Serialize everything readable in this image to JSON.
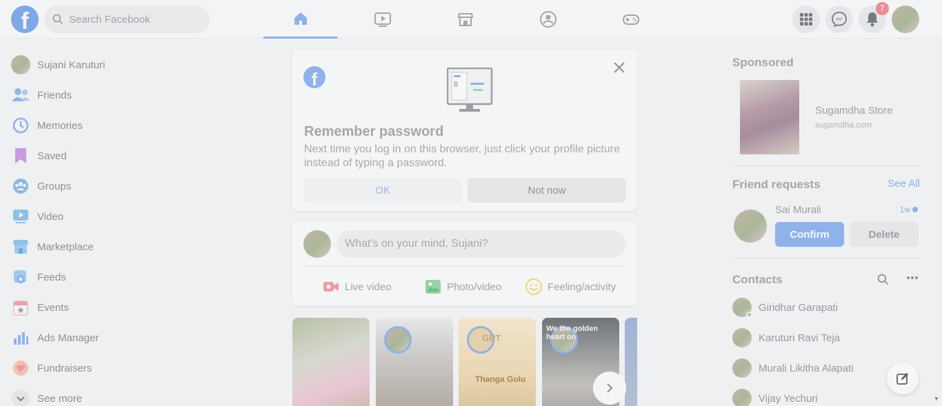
{
  "app": {
    "logo": "f"
  },
  "search": {
    "placeholder": "Search Facebook"
  },
  "nav": {
    "tabs": [
      {
        "name": "home-icon"
      },
      {
        "name": "watch-icon"
      },
      {
        "name": "marketplace-icon"
      },
      {
        "name": "groups-icon"
      },
      {
        "name": "gaming-icon"
      }
    ],
    "notifications_count": "7"
  },
  "sidebar": {
    "profile_name": "Sujani Karuturi",
    "items": [
      {
        "label": "Friends",
        "icon": "friends-icon"
      },
      {
        "label": "Memories",
        "icon": "memories-icon"
      },
      {
        "label": "Saved",
        "icon": "saved-icon"
      },
      {
        "label": "Groups",
        "icon": "groups-icon"
      },
      {
        "label": "Video",
        "icon": "video-icon"
      },
      {
        "label": "Marketplace",
        "icon": "marketplace-icon"
      },
      {
        "label": "Feeds",
        "icon": "feeds-icon"
      },
      {
        "label": "Events",
        "icon": "events-icon"
      },
      {
        "label": "Ads Manager",
        "icon": "ads-manager-icon"
      },
      {
        "label": "Fundraisers",
        "icon": "fundraisers-icon"
      }
    ],
    "see_more": "See more"
  },
  "remember_password": {
    "title": "Remember password",
    "description": "Next time you log in on this browser, just click your profile picture instead of typing a password.",
    "ok_label": "OK",
    "not_now_label": "Not now"
  },
  "composer": {
    "placeholder": "What's on your mind, Sujani?",
    "actions": [
      "Live video",
      "Photo/video",
      "Feeling/activity"
    ]
  },
  "stories": {
    "story3_text": "Thanga Golu",
    "story3_logo": "GRT",
    "story4_text": "We the golden heart on"
  },
  "right": {
    "sponsored_title": "Sponsored",
    "ad": {
      "name": "Sugamdha Store",
      "url": "sugamdha.com"
    },
    "friend_requests_title": "Friend requests",
    "see_all": "See All",
    "request": {
      "name": "Sai Murali",
      "time": "1w",
      "confirm": "Confirm",
      "delete": "Delete"
    },
    "contacts_title": "Contacts",
    "contacts": [
      "Giridhar Garapati",
      "Karuturi Ravi Teja",
      "Murali Likitha Alapati",
      "Vijay Yechuri"
    ]
  },
  "colors": {
    "brand": "#7fa8e8",
    "accent": "#8fb2ea",
    "badge": "#eb8a95"
  }
}
